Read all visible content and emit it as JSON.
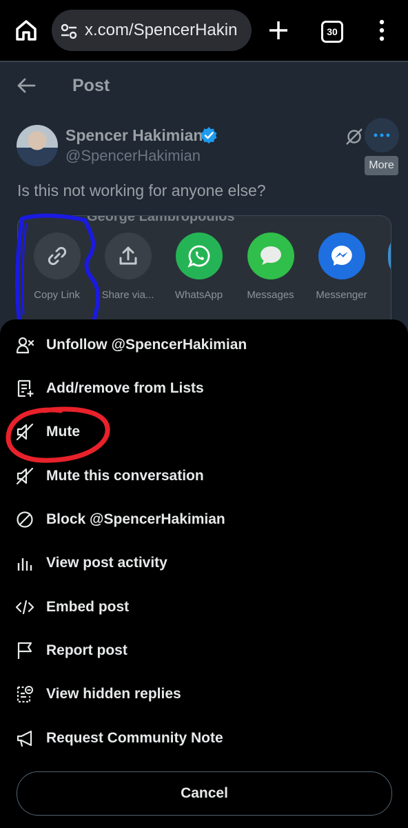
{
  "browser": {
    "url": "x.com/SpencerHakin",
    "tab_count": "30"
  },
  "post": {
    "header_title": "Post",
    "author_name": "Spencer Hakimian",
    "author_handle": "@SpencerHakimian",
    "more_tooltip": "More",
    "text": "Is this not working for anyone else?",
    "quoted_author": "George Lambropoulos"
  },
  "share_sheet": {
    "items": [
      {
        "label": "Copy Link",
        "icon": "link-icon",
        "color": "#3a4047"
      },
      {
        "label": "Share via...",
        "icon": "share-icon",
        "color": "#3a4047"
      },
      {
        "label": "WhatsApp",
        "icon": "whatsapp-icon",
        "color": "#25b455"
      },
      {
        "label": "Messages",
        "icon": "messages-icon",
        "color": "#2fbf4a"
      },
      {
        "label": "Messenger",
        "icon": "messenger-icon",
        "color": "#1e6fe0"
      }
    ]
  },
  "menu": {
    "items": [
      {
        "label": "Unfollow @SpencerHakimian",
        "icon": "unfollow-icon"
      },
      {
        "label": "Add/remove from Lists",
        "icon": "list-icon"
      },
      {
        "label": "Mute",
        "icon": "mute-icon"
      },
      {
        "label": "Mute this conversation",
        "icon": "mute-conversation-icon"
      },
      {
        "label": "Block @SpencerHakimian",
        "icon": "block-icon"
      },
      {
        "label": "View post activity",
        "icon": "activity-icon"
      },
      {
        "label": "Embed post",
        "icon": "embed-icon"
      },
      {
        "label": "Report post",
        "icon": "flag-icon"
      },
      {
        "label": "View hidden replies",
        "icon": "hidden-replies-icon"
      },
      {
        "label": "Request Community Note",
        "icon": "megaphone-icon"
      }
    ],
    "cancel_label": "Cancel"
  },
  "colors": {
    "accent_blue": "#1d9bf0",
    "annotation_red": "#e8212b",
    "annotation_blue": "#1a1ae0"
  }
}
